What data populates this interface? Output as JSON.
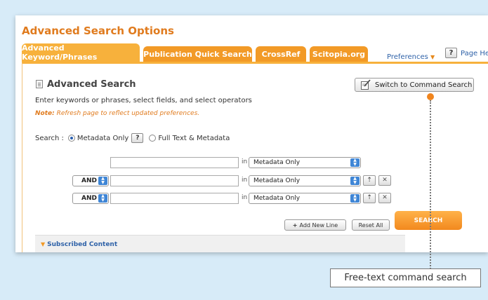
{
  "page_title": "Advanced Search Options",
  "tabs": [
    {
      "label": "Advanced Keyword/Phrases",
      "active": true
    },
    {
      "label": "Publication Quick Search",
      "active": false
    },
    {
      "label": "CrossRef",
      "active": false
    },
    {
      "label": "Scitopia.org",
      "active": false
    }
  ],
  "preferences_label": "Preferences",
  "help_glyph": "?",
  "page_help_label": "Page Help",
  "section_title": "Advanced Search",
  "instructions": "Enter keywords or phrases, select fields, and select operators",
  "note_label": "Note:",
  "note_text": "Refresh page to reflect updated preferences.",
  "switch_button_label": "Switch to Command Search",
  "search_scope": {
    "label": "Search :",
    "option_metadata": "Metadata Only",
    "option_fulltext": "Full Text & Metadata",
    "selected": "Metadata Only"
  },
  "rows": [
    {
      "operator": "",
      "value": "",
      "in_label": "in",
      "field": "Metadata Only"
    },
    {
      "operator": "AND",
      "value": "",
      "in_label": "in",
      "field": "Metadata Only"
    },
    {
      "operator": "AND",
      "value": "",
      "in_label": "in",
      "field": "Metadata Only"
    }
  ],
  "add_line_label": "Add New Line",
  "reset_label": "Reset All",
  "search_button_label": "SEARCH",
  "subscribed_label": "Subscribed Content",
  "callout_text": "Free-text command search",
  "colors": {
    "accent": "#f29a27",
    "link": "#2f62a8",
    "callout_dot": "#f0851e"
  }
}
